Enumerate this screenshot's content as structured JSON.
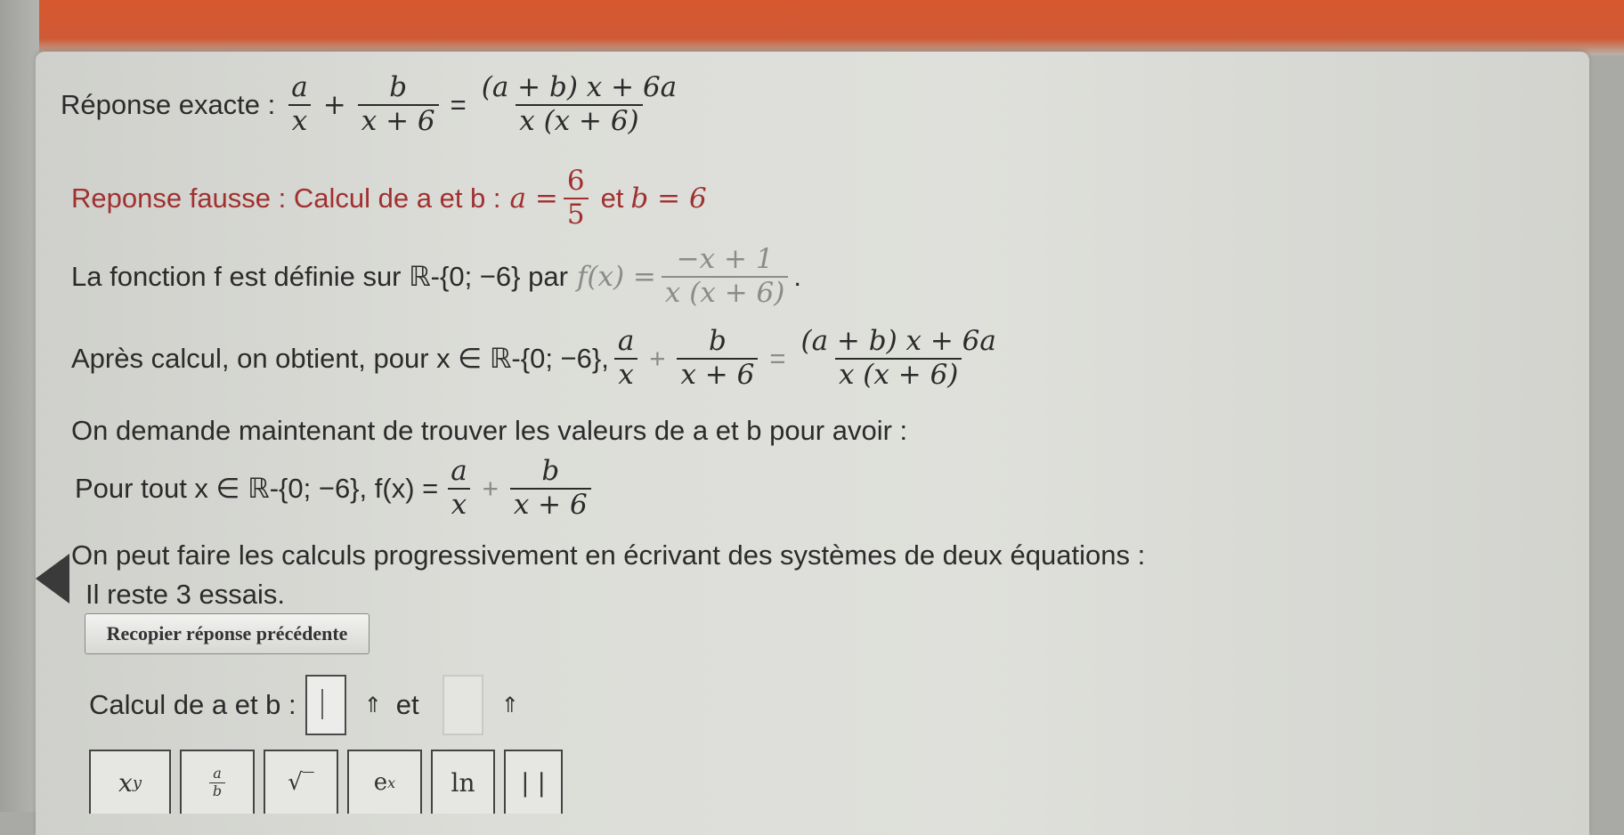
{
  "exact_answer": {
    "label": "Réponse exacte :",
    "lhs1_num": "a",
    "lhs1_den": "x",
    "plus": "+",
    "lhs2_num": "b",
    "lhs2_den": "x + 6",
    "eq": "=",
    "rhs_num": "(a + b) x + 6a",
    "rhs_den": "x (x + 6)"
  },
  "wrong_answer": {
    "label": "Reponse fausse : Calcul de a et b :",
    "a_label": "a =",
    "a_num": "6",
    "a_den": "5",
    "et": "et",
    "b_value": "b = 6"
  },
  "definition": {
    "text": "La fonction f est définie sur ℝ-{0; −6} par",
    "f_lhs": "f(x) =",
    "f_num": "−x + 1",
    "f_den": "x (x + 6)",
    "end": "."
  },
  "after_calc": {
    "text": "Après calcul, on obtient, pour x ∈ ℝ-{0; −6},",
    "t1_num": "a",
    "t1_den": "x",
    "plus": "+",
    "t2_num": "b",
    "t2_den": "x + 6",
    "eq": "=",
    "r_num": "(a + b) x + 6a",
    "r_den": "x (x + 6)"
  },
  "demand": {
    "text": "On demande maintenant de trouver les valeurs de a et b pour avoir :"
  },
  "for_all": {
    "text": "Pour tout x ∈ ℝ-{0; −6}, f(x) =",
    "t1_num": "a",
    "t1_den": "x",
    "plus": "+",
    "t2_num": "b",
    "t2_den": "x + 6"
  },
  "systems": {
    "text": "On peut faire les calculs progressivement en écrivant des systèmes de deux équations :"
  },
  "attempts": {
    "text": "Il reste 3 essais."
  },
  "buttons": {
    "recopier": "Recopier réponse précédente"
  },
  "calc": {
    "label": "Calcul de a et b :",
    "arrow": "⇑",
    "et": "et"
  },
  "toolbar": {
    "power_base": "x",
    "power_exp": "y",
    "frac_num": "a",
    "frac_den": "b",
    "sqrt": "√‾",
    "exp_base": "e",
    "exp_sup": "x",
    "ln": "ln",
    "abs": "| |"
  },
  "colors": {
    "banner": "#d6582e",
    "wrong_text": "#a13030",
    "panel": "#dfe0db"
  }
}
